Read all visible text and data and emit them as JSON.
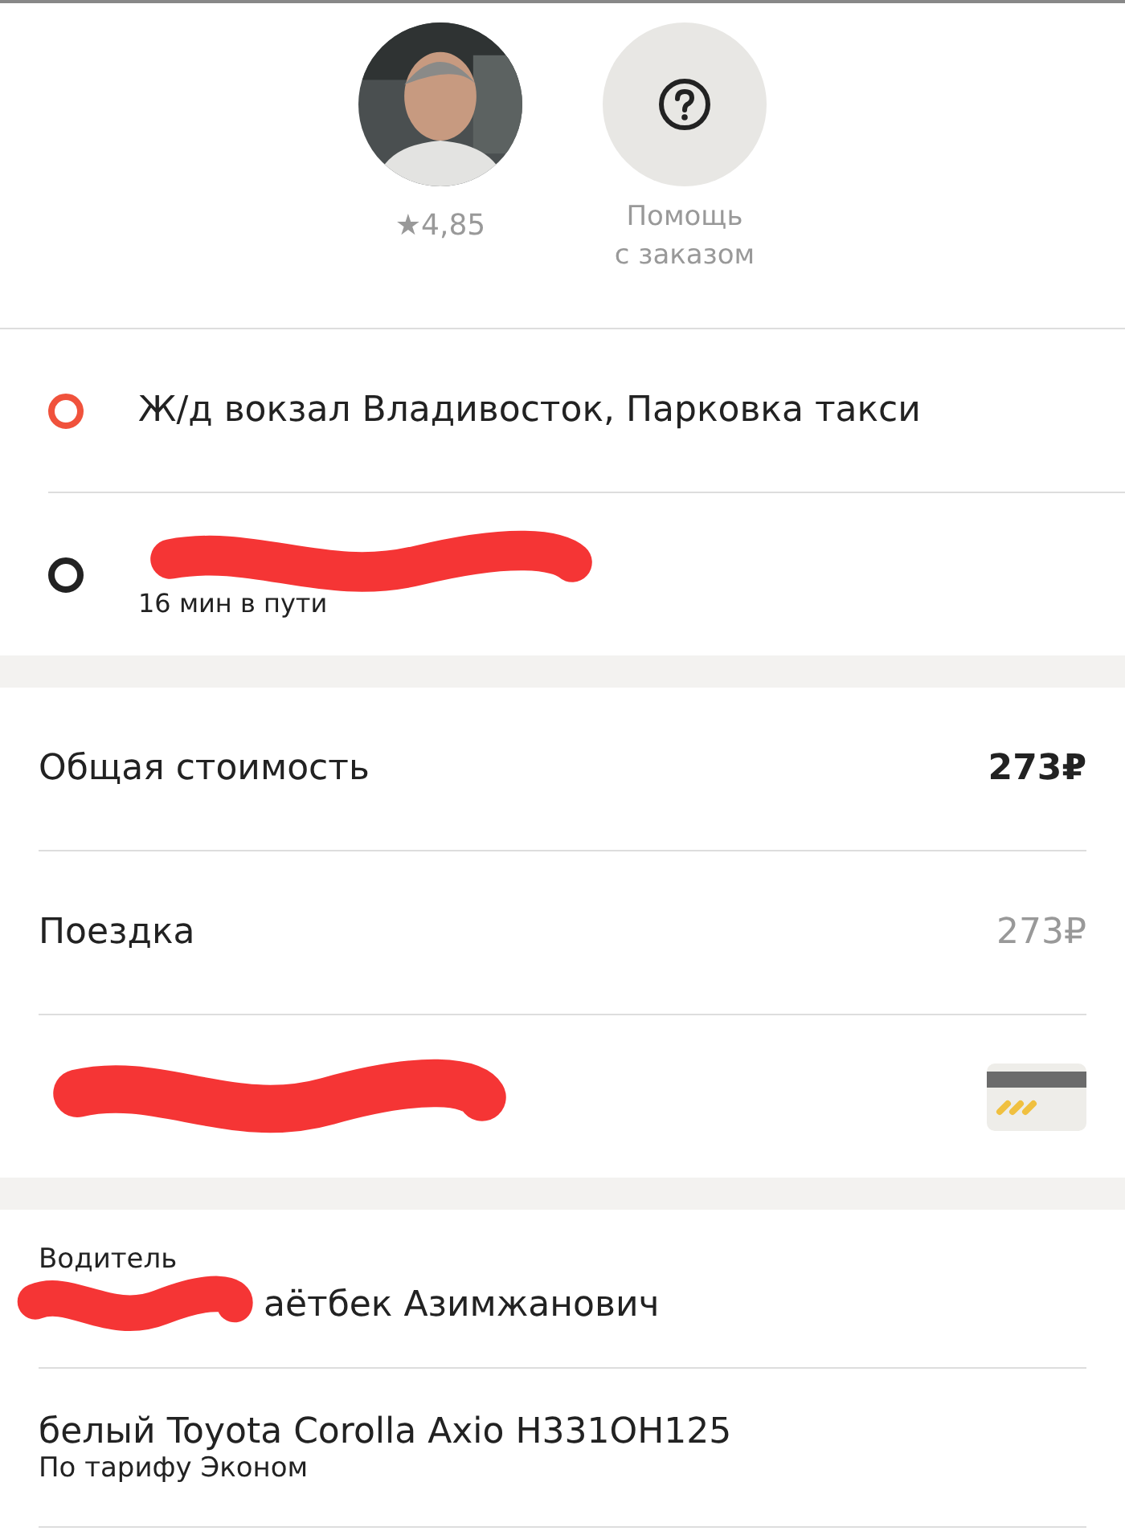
{
  "header": {
    "rating": "★4,85",
    "help": {
      "label": "Помощь\nс заказом"
    }
  },
  "route": [
    {
      "kind": "origin",
      "address": "Ж/д вокзал Владивосток, Парковка такси",
      "redacted": false
    },
    {
      "kind": "destination",
      "redacted": true,
      "duration": "16 мин в пути"
    }
  ],
  "price": {
    "rows": [
      {
        "kind": "total",
        "label": "Общая стоимость",
        "value": "273₽"
      },
      {
        "kind": "item",
        "label": "Поездка",
        "value": "273₽"
      },
      {
        "kind": "payment",
        "redacted": true
      }
    ]
  },
  "driver": {
    "caption": "Водитель",
    "name": "аётбек Азимжанович",
    "name_redacted": true,
    "car": "белый Toyota Corolla Axio Н331ОН125",
    "tariff": "По тарифу Эконом"
  }
}
